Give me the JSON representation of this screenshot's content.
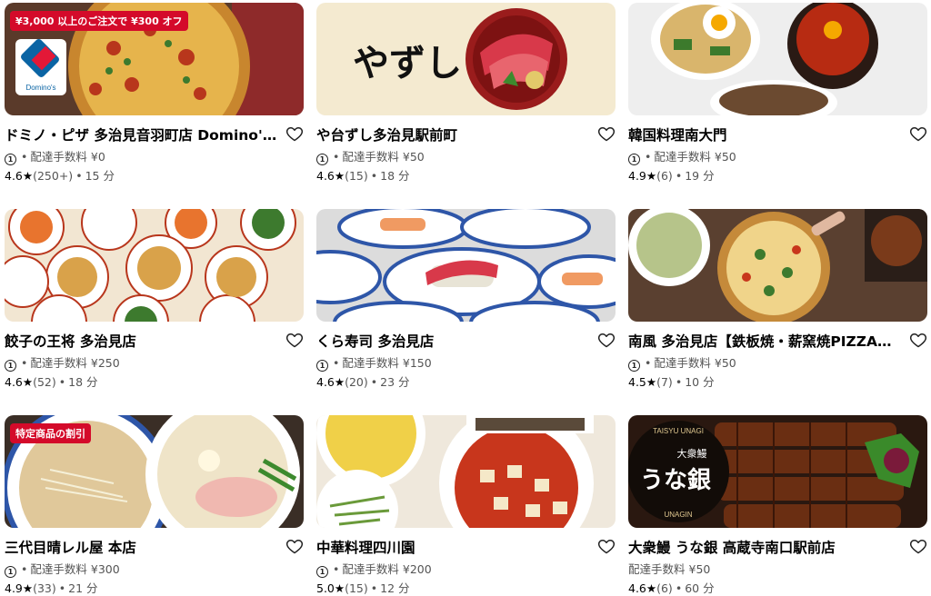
{
  "restaurants": [
    {
      "name": "ドミノ・ピザ 多治見音羽町店 Domino's Pizza",
      "badge": "¥3,000 以上のご注文で ¥300 オフ",
      "fee_label": "配達手数料",
      "fee": "¥0",
      "rating": "4.6★",
      "reviews": "(250+)",
      "time": "15 分",
      "show_coin": true,
      "image": "pizza",
      "logo": "Domino's"
    },
    {
      "name": "や台ずし多治見駅前町",
      "badge": "",
      "fee_label": "配達手数料",
      "fee": "¥50",
      "rating": "4.6★",
      "reviews": "(15)",
      "time": "18 分",
      "show_coin": true,
      "image": "sushi-bowl",
      "logo": "やずし"
    },
    {
      "name": "韓国料理南大門",
      "badge": "",
      "fee_label": "配達手数料",
      "fee": "¥50",
      "rating": "4.9★",
      "reviews": "(6)",
      "time": "19 分",
      "show_coin": true,
      "image": "korean"
    },
    {
      "name": "餃子の王将 多治見店",
      "badge": "",
      "fee_label": "配達手数料",
      "fee": "¥250",
      "rating": "4.6★",
      "reviews": "(52)",
      "time": "18 分",
      "show_coin": true,
      "image": "gyoza"
    },
    {
      "name": "くら寿司 多治見店",
      "badge": "",
      "fee_label": "配達手数料",
      "fee": "¥150",
      "rating": "4.6★",
      "reviews": "(20)",
      "time": "23 分",
      "show_coin": true,
      "image": "kura"
    },
    {
      "name": "南風 多治見店【鉄板焼・薪窯焼PIZZA・…",
      "badge": "",
      "fee_label": "配達手数料",
      "fee": "¥50",
      "rating": "4.5★",
      "reviews": "(7)",
      "time": "10 分",
      "show_coin": true,
      "image": "teppan"
    },
    {
      "name": "三代目晴レル屋 本店",
      "badge": "特定商品の割引",
      "fee_label": "配達手数料",
      "fee": "¥300",
      "rating": "4.9★",
      "reviews": "(33)",
      "time": "21 分",
      "show_coin": true,
      "image": "ramen"
    },
    {
      "name": "中華料理四川園",
      "badge": "",
      "fee_label": "配達手数料",
      "fee": "¥200",
      "rating": "5.0★",
      "reviews": "(15)",
      "time": "12 分",
      "show_coin": true,
      "image": "mapo"
    },
    {
      "name": "大衆鰻 うな銀 高蔵寺南口駅前店",
      "badge": "",
      "fee_label": "配達手数料",
      "fee": "¥50",
      "rating": "4.6★",
      "reviews": "(6)",
      "time": "60 分",
      "show_coin": false,
      "image": "unagi",
      "logo": "うな銀",
      "logo_sub": "大衆鰻",
      "logo_top": "TAISYU UNAGI",
      "logo_bottom": "UNAGIN"
    }
  ],
  "icons": {
    "heart": "heart-icon",
    "coin": "coin-icon"
  },
  "coin_glyph": "①",
  "separator": "•"
}
